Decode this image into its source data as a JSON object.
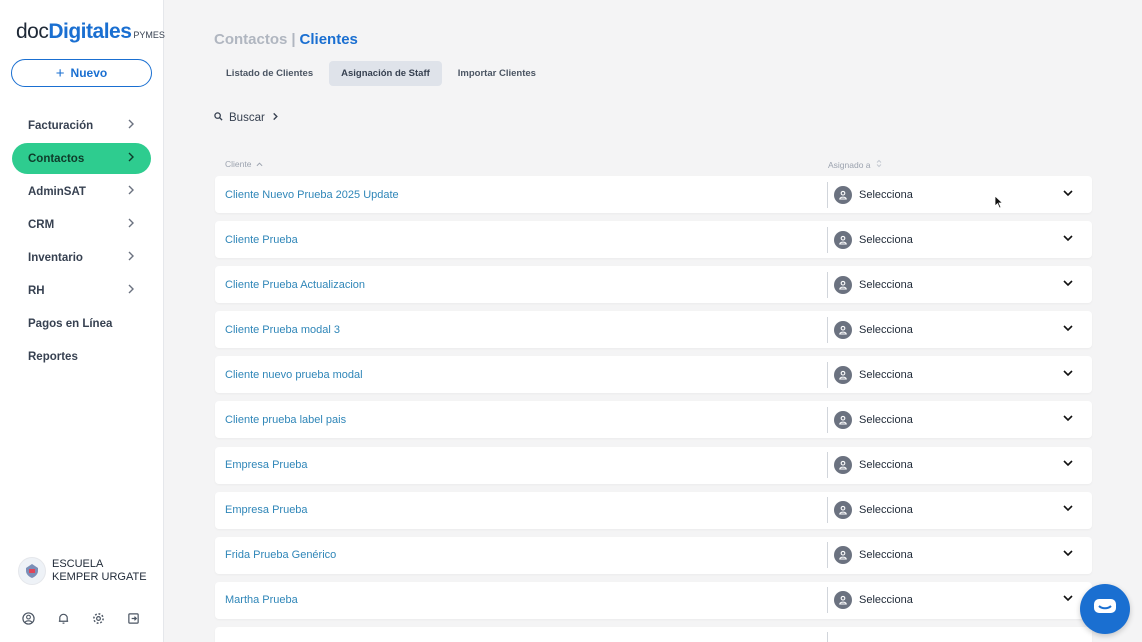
{
  "brand": {
    "part1": "doc",
    "part2": "Digitales",
    "part3": "PYMES"
  },
  "new_button": {
    "label": "Nuevo"
  },
  "nav": [
    {
      "label": "Facturación",
      "has_arrow": true
    },
    {
      "label": "Contactos",
      "has_arrow": true,
      "active": true
    },
    {
      "label": "AdminSAT",
      "has_arrow": true
    },
    {
      "label": "CRM",
      "has_arrow": true
    },
    {
      "label": "Inventario",
      "has_arrow": true
    },
    {
      "label": "RH",
      "has_arrow": true
    },
    {
      "label": "Pagos en Línea",
      "has_arrow": false
    },
    {
      "label": "Reportes",
      "has_arrow": false
    }
  ],
  "user": {
    "name": "ESCUELA KEMPER URGATE"
  },
  "header": {
    "section": "Contactos",
    "separator": "|",
    "page": "Clientes"
  },
  "tabs": [
    "Listado de Clientes",
    "Asignación de Staff",
    "Importar Clientes"
  ],
  "search": {
    "label": "Buscar"
  },
  "table": {
    "col_client": "Cliente",
    "col_assigned": "Asignado a",
    "rows": [
      {
        "name": "Cliente Nuevo Prueba 2025 Update",
        "assigned": "Selecciona"
      },
      {
        "name": "Cliente Prueba",
        "assigned": "Selecciona"
      },
      {
        "name": "Cliente Prueba Actualizacion",
        "assigned": "Selecciona"
      },
      {
        "name": "Cliente Prueba modal 3",
        "assigned": "Selecciona"
      },
      {
        "name": "Cliente nuevo prueba modal",
        "assigned": "Selecciona"
      },
      {
        "name": "Cliente prueba label pais",
        "assigned": "Selecciona"
      },
      {
        "name": "Empresa Prueba",
        "assigned": "Selecciona"
      },
      {
        "name": "Empresa Prueba",
        "assigned": "Selecciona"
      },
      {
        "name": "Frida Prueba Genérico",
        "assigned": "Selecciona"
      },
      {
        "name": "Martha Prueba",
        "assigned": "Selecciona"
      },
      {
        "name": "",
        "assigned": ""
      }
    ]
  }
}
